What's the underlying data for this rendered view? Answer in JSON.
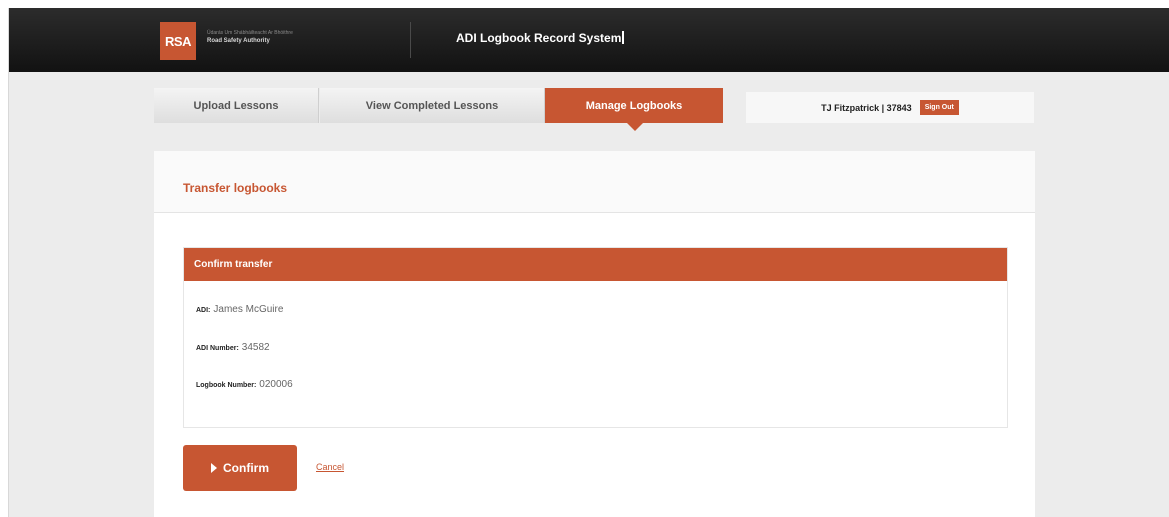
{
  "header": {
    "logo_text": "RSA",
    "org_line1": "Údarás Um Shábháilteacht Ar Bhóithre",
    "org_line2": "Road Safety Authority",
    "app_title": "ADI Logbook Record System"
  },
  "nav": {
    "tabs": [
      {
        "label": "Upload Lessons",
        "active": false
      },
      {
        "label": "View Completed Lessons",
        "active": false
      },
      {
        "label": "Manage Logbooks",
        "active": true
      }
    ]
  },
  "user": {
    "name": "TJ Fitzpatrick | 37843",
    "signout_label": "Sign Out"
  },
  "page": {
    "title": "Transfer logbooks"
  },
  "confirm_panel": {
    "heading": "Confirm transfer",
    "fields": [
      {
        "label": "ADI:",
        "value": "James McGuire"
      },
      {
        "label": "ADI Number:",
        "value": "34582"
      },
      {
        "label": "Logbook Number:",
        "value": "020006"
      }
    ]
  },
  "actions": {
    "confirm_label": "Confirm",
    "cancel_label": "Cancel"
  },
  "colors": {
    "accent": "#c75632",
    "header_bg": "#1a1a1a",
    "page_bg": "#ececec"
  }
}
